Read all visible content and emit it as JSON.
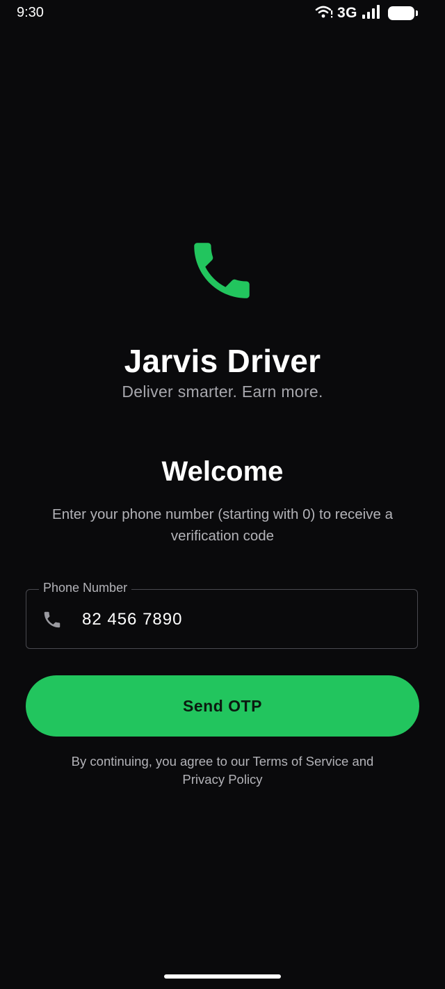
{
  "status_bar": {
    "time": "9:30",
    "network": "3G",
    "icons": [
      "wifi-icon",
      "signal-icon",
      "battery-icon"
    ]
  },
  "brand": {
    "icon": "phone-icon",
    "title": "Jarvis Driver",
    "tagline": "Deliver smarter. Earn more."
  },
  "welcome": {
    "heading": "Welcome",
    "description": "Enter your phone number (starting with 0) to receive a verification code"
  },
  "phone_field": {
    "label": "Phone Number",
    "value": "82 456 7890",
    "icon": "phone-icon"
  },
  "send_button": {
    "label": "Send OTP"
  },
  "terms": {
    "text": "By continuing, you agree to our Terms of Service and Privacy Policy"
  },
  "colors": {
    "background": "#0a0a0c",
    "accent": "#22c55e",
    "text_primary": "#ffffff",
    "text_secondary": "#b3b3b8",
    "field_border": "#4a4a50"
  }
}
